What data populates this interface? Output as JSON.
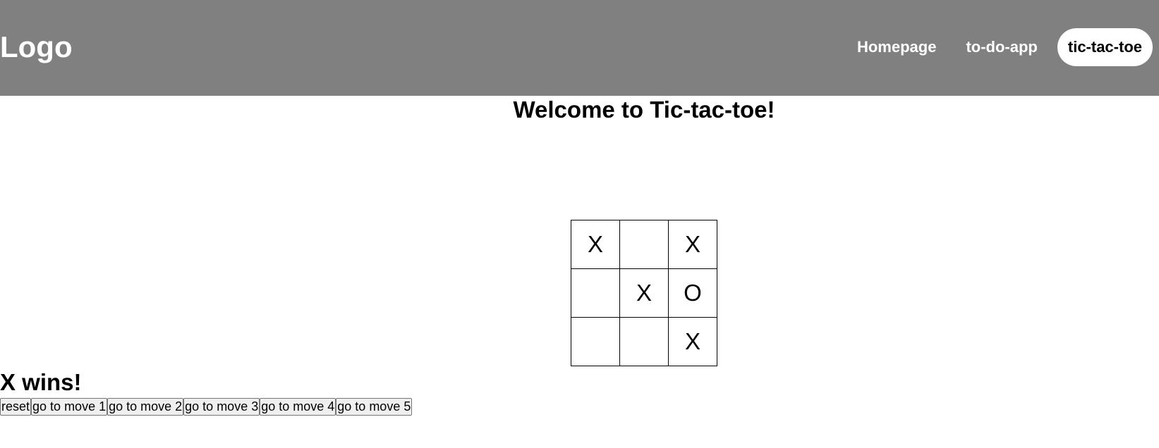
{
  "header": {
    "logo": "Logo",
    "nav": [
      {
        "label": "Homepage",
        "active": false
      },
      {
        "label": "to-do-app",
        "active": false
      },
      {
        "label": "tic-tac-toe",
        "active": true
      }
    ]
  },
  "main": {
    "title": "Welcome to Tic-tac-toe!",
    "board": [
      "X",
      "",
      "X",
      "",
      "X",
      "O",
      "",
      "",
      "X"
    ],
    "status": "X wins!",
    "buttons": [
      "reset",
      "go to move 1",
      "go to move 2",
      "go to move 3",
      "go to move 4",
      "go to move 5"
    ]
  },
  "colors": {
    "header_bg": "#808080",
    "active_nav_bg": "#ffffff"
  }
}
